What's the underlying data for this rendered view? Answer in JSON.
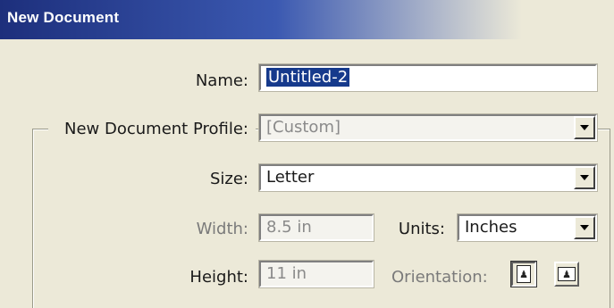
{
  "dialog": {
    "title": "New Document"
  },
  "form": {
    "name_label": "Name:",
    "name_value": "Untitled-2",
    "profile_label": "New Document Profile:",
    "profile_value": "[Custom]",
    "size_label": "Size:",
    "size_value": "Letter",
    "width_label": "Width:",
    "width_value": "8.5 in",
    "units_label": "Units:",
    "units_value": "Inches",
    "height_label": "Height:",
    "height_value": "11 in",
    "orientation_label": "Orientation:",
    "orientation_selected": "portrait"
  },
  "icons": {
    "dropdown": "chevron-down-icon",
    "portrait": "portrait-icon",
    "landscape": "landscape-icon"
  },
  "colors": {
    "title_bar": "#1d2f7c",
    "selection": "#163a8c",
    "dialog_bg": "#ece9d8"
  }
}
